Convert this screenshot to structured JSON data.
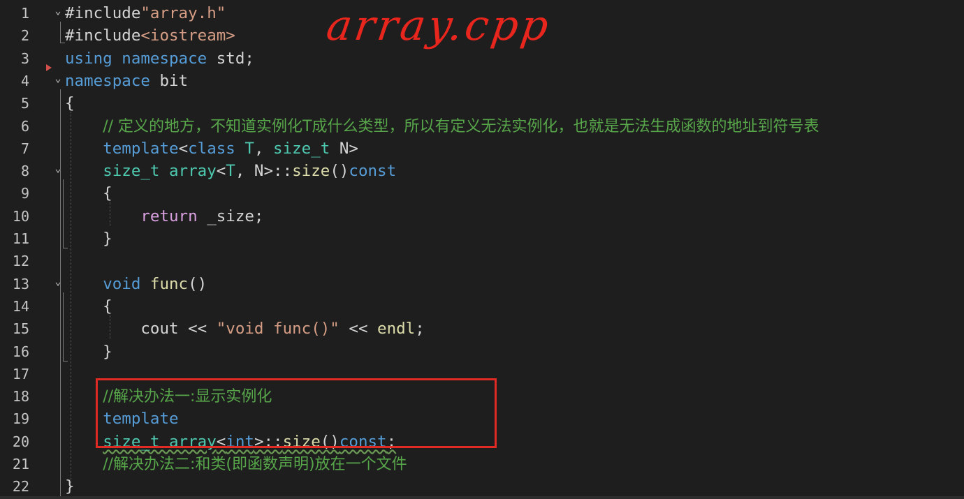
{
  "editor": {
    "language": "cpp",
    "annotation": "array.cpp",
    "lines": [
      {
        "num": "1",
        "fold": "⌄",
        "segments": [
          {
            "t": "#include",
            "c": "pl"
          },
          {
            "t": "\"array.h\"",
            "c": "str"
          }
        ]
      },
      {
        "num": "2",
        "fold": "",
        "segments": [
          {
            "t": "#include",
            "c": "pl"
          },
          {
            "t": "<iostream>",
            "c": "str"
          }
        ]
      },
      {
        "num": "3",
        "fold": "",
        "segments": [
          {
            "t": "using",
            "c": "kw"
          },
          {
            "t": " ",
            "c": "pl"
          },
          {
            "t": "namespace",
            "c": "kw"
          },
          {
            "t": " std;",
            "c": "pl"
          }
        ]
      },
      {
        "num": "4",
        "fold": "⌄",
        "segments": [
          {
            "t": "namespace",
            "c": "kw"
          },
          {
            "t": " bit",
            "c": "pl"
          }
        ]
      },
      {
        "num": "5",
        "fold": "",
        "segments": [
          {
            "t": "{",
            "c": "pl"
          }
        ]
      },
      {
        "num": "6",
        "fold": "",
        "segments": [
          {
            "t": "    ",
            "c": "pl"
          },
          {
            "t": "// 定义的地方，不知道实例化T成什么类型，所以有定义无法实例化，也就是无法生成函数的地址到符号表",
            "c": "cm"
          }
        ]
      },
      {
        "num": "7",
        "fold": "",
        "segments": [
          {
            "t": "    ",
            "c": "pl"
          },
          {
            "t": "template",
            "c": "kw"
          },
          {
            "t": "<",
            "c": "pl"
          },
          {
            "t": "class",
            "c": "kw"
          },
          {
            "t": " ",
            "c": "pl"
          },
          {
            "t": "T",
            "c": "ty"
          },
          {
            "t": ", ",
            "c": "pl"
          },
          {
            "t": "size_t",
            "c": "ty"
          },
          {
            "t": " N>",
            "c": "pl"
          }
        ]
      },
      {
        "num": "8",
        "fold": "⌄",
        "segments": [
          {
            "t": "    ",
            "c": "pl"
          },
          {
            "t": "size_t",
            "c": "ty"
          },
          {
            "t": " ",
            "c": "pl"
          },
          {
            "t": "array",
            "c": "ty"
          },
          {
            "t": "<",
            "c": "pl"
          },
          {
            "t": "T",
            "c": "ty"
          },
          {
            "t": ", N>::",
            "c": "pl"
          },
          {
            "t": "size",
            "c": "fn"
          },
          {
            "t": "()",
            "c": "pl"
          },
          {
            "t": "const",
            "c": "kw"
          }
        ]
      },
      {
        "num": "9",
        "fold": "",
        "segments": [
          {
            "t": "    {",
            "c": "pl"
          }
        ]
      },
      {
        "num": "10",
        "fold": "",
        "segments": [
          {
            "t": "        ",
            "c": "pl"
          },
          {
            "t": "return",
            "c": "kw2"
          },
          {
            "t": " _size;",
            "c": "pl"
          }
        ]
      },
      {
        "num": "11",
        "fold": "",
        "segments": [
          {
            "t": "    }",
            "c": "pl"
          }
        ]
      },
      {
        "num": "12",
        "fold": "",
        "segments": []
      },
      {
        "num": "13",
        "fold": "⌄",
        "segments": [
          {
            "t": "    ",
            "c": "pl"
          },
          {
            "t": "void",
            "c": "kw"
          },
          {
            "t": " ",
            "c": "pl"
          },
          {
            "t": "func",
            "c": "fn"
          },
          {
            "t": "()",
            "c": "pl"
          }
        ]
      },
      {
        "num": "14",
        "fold": "",
        "segments": [
          {
            "t": "    {",
            "c": "pl"
          }
        ]
      },
      {
        "num": "15",
        "fold": "",
        "segments": [
          {
            "t": "        cout << ",
            "c": "pl"
          },
          {
            "t": "\"void func()\"",
            "c": "str"
          },
          {
            "t": " << ",
            "c": "pl"
          },
          {
            "t": "endl",
            "c": "fn"
          },
          {
            "t": ";",
            "c": "pl"
          }
        ]
      },
      {
        "num": "16",
        "fold": "",
        "segments": [
          {
            "t": "    }",
            "c": "pl"
          }
        ]
      },
      {
        "num": "17",
        "fold": "",
        "segments": []
      },
      {
        "num": "18",
        "fold": "",
        "segments": [
          {
            "t": "    ",
            "c": "pl"
          },
          {
            "t": "//解决办法一:显示实例化",
            "c": "cm"
          }
        ]
      },
      {
        "num": "19",
        "fold": "",
        "segments": [
          {
            "t": "    ",
            "c": "pl"
          },
          {
            "t": "template",
            "c": "kw"
          }
        ]
      },
      {
        "num": "20",
        "fold": "",
        "segments": [
          {
            "t": "    ",
            "c": "pl"
          },
          {
            "t": "size_t array",
            "c": "ty ul"
          },
          {
            "t": "<",
            "c": "pl ul"
          },
          {
            "t": "int",
            "c": "kw ul"
          },
          {
            "t": ">::",
            "c": "pl ul"
          },
          {
            "t": "size",
            "c": "fn ul"
          },
          {
            "t": "()",
            "c": "pl ul"
          },
          {
            "t": "const",
            "c": "kw ul"
          },
          {
            "t": ";",
            "c": "pl ul"
          }
        ]
      },
      {
        "num": "21",
        "fold": "",
        "segments": [
          {
            "t": "    ",
            "c": "pl"
          },
          {
            "t": "//解决办法二:和类(即函数声明)放在一个文件",
            "c": "cm"
          }
        ]
      },
      {
        "num": "22",
        "fold": "",
        "segments": [
          {
            "t": "}",
            "c": "pl"
          }
        ]
      }
    ]
  }
}
